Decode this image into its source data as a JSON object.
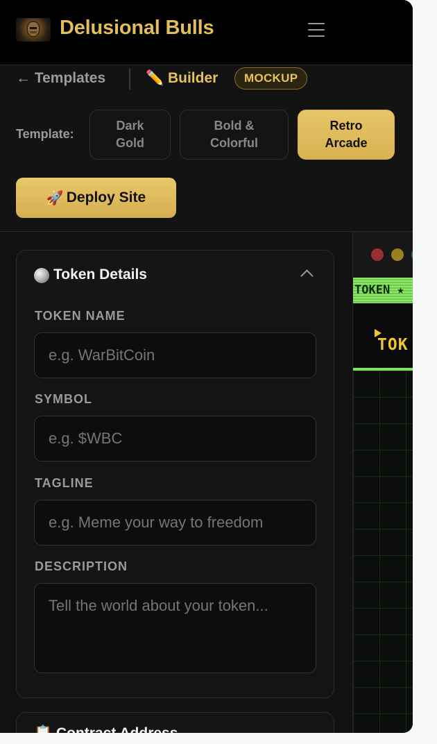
{
  "header": {
    "brand": "Delusional Bulls",
    "logo_icon": "bull-logo-icon",
    "menu_icon": "hamburger-menu-icon"
  },
  "nav": {
    "back_label": "← Templates",
    "builder_label": "✏️ Builder",
    "badge": "MOCKUP"
  },
  "templates": {
    "label": "Template:",
    "options": [
      {
        "line1": "Dark",
        "line2": "Gold",
        "active": false
      },
      {
        "line1": "Bold &",
        "line2": "Colorful",
        "active": false
      },
      {
        "line1": "Retro",
        "line2": "Arcade",
        "active": true
      }
    ]
  },
  "deploy": {
    "icon": "🚀",
    "label": "Deploy Site"
  },
  "token_card": {
    "icon": "coin-icon",
    "title": "Token Details",
    "fields": [
      {
        "label": "TOKEN NAME",
        "placeholder": "e.g. WarBitCoin",
        "value": ""
      },
      {
        "label": "SYMBOL",
        "placeholder": "e.g. $WBC",
        "value": ""
      },
      {
        "label": "TAGLINE",
        "placeholder": "e.g. Meme your way to freedom",
        "value": ""
      },
      {
        "label": "DESCRIPTION",
        "placeholder": "Tell the world about your token...",
        "value": ""
      }
    ]
  },
  "contract_card": {
    "title": "📋 Contract Address"
  },
  "preview": {
    "dots": [
      "#9b2e2e",
      "#9b7d22",
      "#2f7a2f"
    ],
    "ticker": "TOKEN ★",
    "hero": "TOK"
  },
  "colors": {
    "accent_gold": "#e2bd5a",
    "ticker_green": "#8fe66a",
    "arcade_yellow": "#f0c533"
  }
}
